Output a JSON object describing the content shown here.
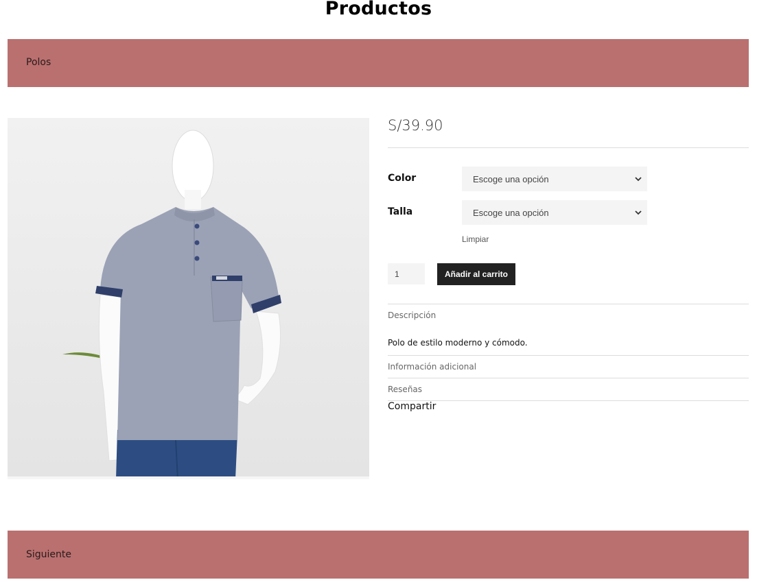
{
  "page": {
    "title": "Productos"
  },
  "category_band": {
    "label": "Polos"
  },
  "product": {
    "image_alt": "Polo gris con cuello mao en maniquí",
    "price": "S/39.90",
    "variations": [
      {
        "label": "Color",
        "placeholder": "Escoge una opción"
      },
      {
        "label": "Talla",
        "placeholder": "Escoge una opción"
      }
    ],
    "clear_label": "Limpiar",
    "quantity": "1",
    "add_to_cart_label": "Añadir al carrito",
    "tabs": {
      "description": "Descripción",
      "description_text": "Polo de estilo moderno y cómodo.",
      "additional_info": "Información adicional",
      "reviews": "Reseñas"
    },
    "share_label": "Compartir"
  },
  "footer_band": {
    "label": "Siguiente"
  },
  "colors": {
    "band": "#b9706f",
    "button": "#222222",
    "shirt": "#9ba2b6"
  }
}
